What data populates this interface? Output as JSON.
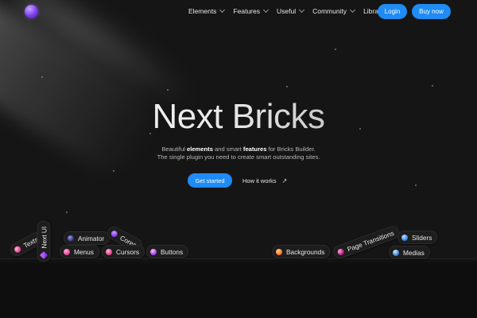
{
  "header": {
    "nav": [
      {
        "label": "Elements",
        "has_dropdown": true
      },
      {
        "label": "Features",
        "has_dropdown": true
      },
      {
        "label": "Useful",
        "has_dropdown": true
      },
      {
        "label": "Community",
        "has_dropdown": true
      },
      {
        "label": "Library",
        "has_dropdown": false
      }
    ],
    "login_label": "Login",
    "buy_label": "Buy now"
  },
  "hero": {
    "title": "Next Bricks",
    "subtitle_line1": {
      "p1": "Beautiful ",
      "b1": "elements",
      "p2": " and smart ",
      "b2": "features",
      "p3": " for Bricks Builder."
    },
    "subtitle_line2": "The single plugin you need to create smart outstanding sites.",
    "cta_primary": "Get started",
    "cta_secondary": "How it works",
    "cta_secondary_icon": "arrow-up-right-icon"
  },
  "chips": [
    {
      "label": "Texts",
      "icon": "pink-orb"
    },
    {
      "label": "Next UI",
      "icon": "purple-diamond"
    },
    {
      "label": "Animator",
      "icon": "dark-orb"
    },
    {
      "label": "Cores",
      "icon": "violet-orb"
    },
    {
      "label": "Menus",
      "icon": "pink-orb"
    },
    {
      "label": "Cursors",
      "icon": "pink-orb"
    },
    {
      "label": "Buttons",
      "icon": "violet-pink-orb"
    },
    {
      "label": "Backgrounds",
      "icon": "orange-orb"
    },
    {
      "label": "Page Transitions",
      "icon": "magenta-orb"
    },
    {
      "label": "Sliders",
      "icon": "blue-orb"
    },
    {
      "label": "Medias",
      "icon": "teal-orb"
    }
  ],
  "colors": {
    "background": "#151515",
    "accent": "#1f8bf4"
  }
}
